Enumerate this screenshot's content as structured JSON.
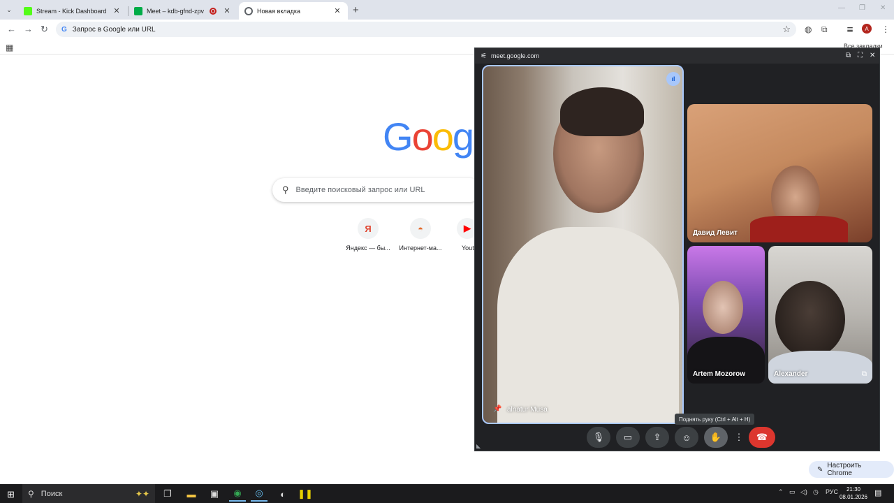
{
  "browser": {
    "tabs": [
      {
        "title": "Stream - Kick Dashboard",
        "color": "#53fc18"
      },
      {
        "title": "Meet – kdb-gfnd-zpv",
        "color": "#00ac47"
      },
      {
        "title": "Новая вкладка",
        "color": "#5f6368"
      }
    ],
    "omnibox_text": "Запрос в Google или URL",
    "profile_letter": "A",
    "all_bookmarks": "Все закладки"
  },
  "newtab": {
    "logo_letters": [
      "G",
      "o",
      "o",
      "g"
    ],
    "search_placeholder": "Введите поисковый запрос или URL",
    "shortcuts": [
      {
        "label": "Яндекс — бы...",
        "icon": "Я"
      },
      {
        "label": "Интернет-ма...",
        "icon": "◓"
      },
      {
        "label": "Yout",
        "icon": "▶"
      }
    ],
    "customize_label": "Настроить Chrome"
  },
  "pip": {
    "url": "meet.google.com",
    "participants": {
      "main": "alnatur Musa",
      "david": "Давид Левит",
      "artem": "Artem Mozorow",
      "alexander": "Alexander"
    },
    "tooltip": "Поднять руку (Ctrl + Alt + H)",
    "end_call_color": "#dc362e"
  },
  "taskbar": {
    "search_label": "Поиск",
    "lang": "РУС",
    "time": "21:30",
    "date": "08.01.2026"
  }
}
